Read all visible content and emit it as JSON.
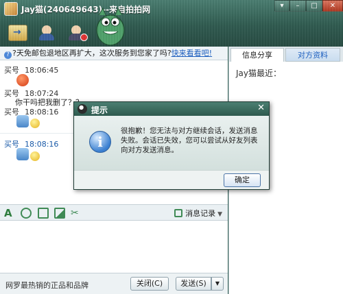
{
  "window": {
    "title": "Jay猫(240649643)--来自拍拍网",
    "controls": {
      "menu": "▾",
      "minimize": "–",
      "maximize": "□",
      "close": "✕"
    }
  },
  "toolbar": {
    "items": [
      "transfer-file",
      "contact",
      "block-user"
    ]
  },
  "notice": {
    "text": "?天免邮包退地区再扩大，这次服务到您家了吗?",
    "link": "快来看看吧!"
  },
  "chat": {
    "messages": [
      {
        "sender": "买号",
        "time": "18:06:45",
        "content": ""
      },
      {
        "sender": "买号",
        "time": "18:07:24",
        "content": "你干吗把我删了？？"
      },
      {
        "sender": "买号",
        "time": "18:08:16",
        "content": ""
      },
      {
        "sender": "买号",
        "time": "18:08:16",
        "content": ""
      }
    ]
  },
  "input_toolbar": {
    "history_label": "消息记录"
  },
  "bottom": {
    "ad_text": "网罗最热销的正品和品牌",
    "close_label": "关闭(C)",
    "send_label": "发送(S)"
  },
  "right_panel": {
    "tabs": [
      "信息分享",
      "对方资料"
    ],
    "active_tab": "信息分享",
    "recent_label": "Jay猫最近："
  },
  "dialog": {
    "title": "提示",
    "close": "✕",
    "message": "很抱歉！您无法与对方继续会话，发送消息失败。会话已失效，您可以尝试从好友列表向对方发送消息。",
    "ok_label": "确定"
  },
  "colors": {
    "header": "#2f5a4f",
    "accent_link": "#1d5fbf"
  }
}
